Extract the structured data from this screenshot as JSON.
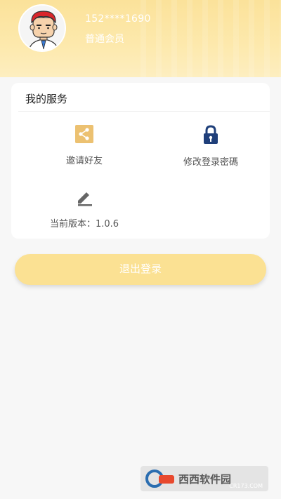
{
  "profile": {
    "phone": "152****1690",
    "membership": "普通会员"
  },
  "services": {
    "title": "我的服务",
    "items": [
      {
        "label": "邀请好友",
        "icon": "share-icon"
      },
      {
        "label": "修改登录密碼",
        "icon": "lock-icon"
      },
      {
        "label": "当前版本：1.0.6",
        "icon": "edit-icon"
      }
    ]
  },
  "actions": {
    "logout_label": "退出登录"
  },
  "watermark": {
    "text": "西西软件园",
    "url": "CR173.COM"
  },
  "colors": {
    "header": "#fbe29a",
    "accent": "#e9c46a",
    "lock_blue": "#1f3f7a",
    "logout_button": "#fbe193"
  }
}
